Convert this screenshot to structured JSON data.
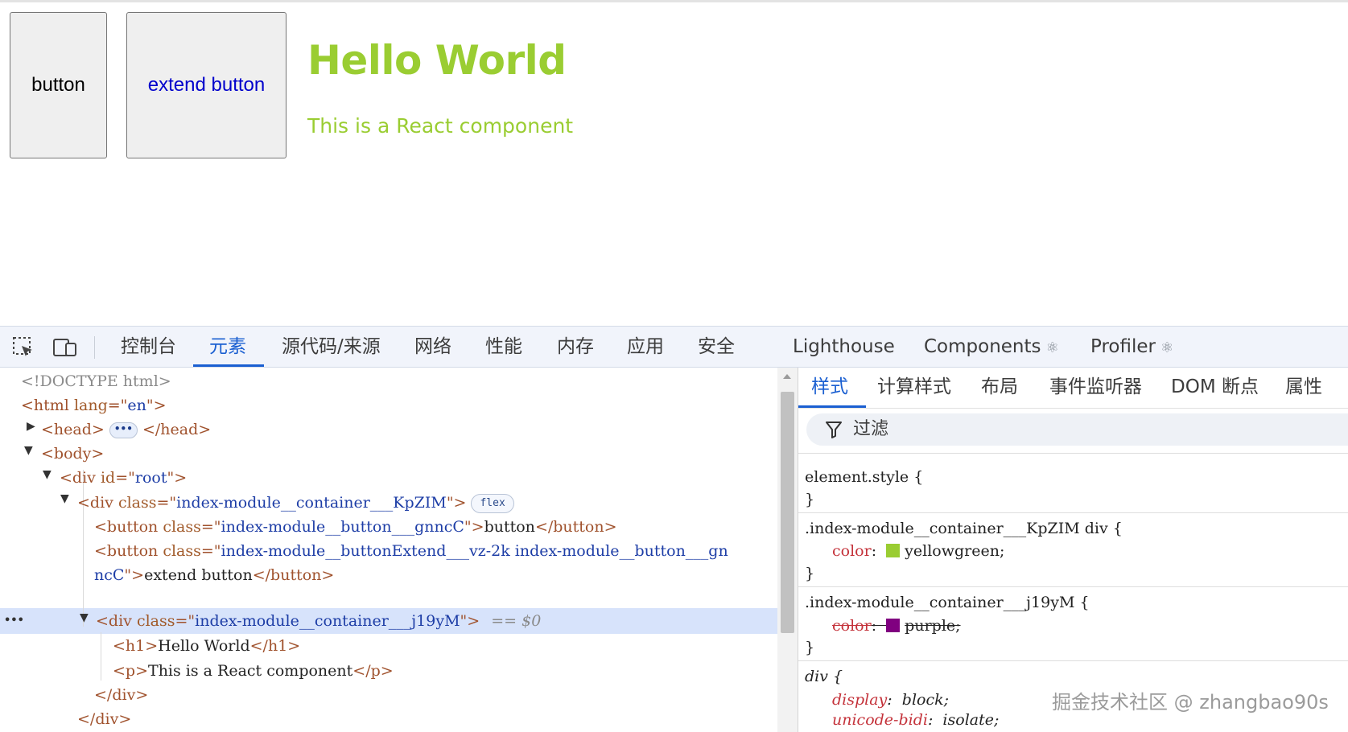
{
  "page": {
    "button1_label": "button",
    "button2_label": "extend button",
    "heading": "Hello World",
    "paragraph": "This is a React component",
    "colors": {
      "heading": "#9acd32",
      "extend_button_text": "#0000cc"
    }
  },
  "devtools": {
    "toolbar": {
      "icons": [
        "inspect-element-icon",
        "device-toolbar-icon"
      ],
      "tabs": {
        "console": "控制台",
        "elements": "元素",
        "sources": "源代码/来源",
        "network": "网络",
        "performance": "性能",
        "memory": "内存",
        "application": "应用",
        "security": "安全",
        "lighthouse": "Lighthouse",
        "components": "Components",
        "profiler": "Profiler"
      },
      "react_glyph": "⚛",
      "active_tab": "元素"
    },
    "elements": {
      "doctype": "<!DOCTYPE html>",
      "html_tag": "html",
      "html_attr": "lang",
      "html_val": "en",
      "head_tag": "head",
      "body_tag": "body",
      "root_tag": "div",
      "root_attr": "id",
      "root_val": "root",
      "container_attr": "class",
      "container_val": "index-module__container___KpZIM",
      "flex_badge": "flex",
      "button1_tag": "button",
      "button1_class": "index-module__button___gnncC",
      "button1_text": "button",
      "button2_class_line1": "index-module__buttonExtend___vz-2k index-module__button___gn",
      "button2_class_line2": "ncC",
      "button2_text": "extend button",
      "inner_container_val": "index-module__container___j19yM",
      "selected_marker": "== $0",
      "h1_tag": "h1",
      "h1_text": "Hello World",
      "p_tag": "p",
      "p_text": "This is a React component",
      "close_div": "div",
      "row_menu": "•••",
      "ellipsis": "•••"
    },
    "styles": {
      "tabs": {
        "styles": "样式",
        "computed": "计算样式",
        "layout": "布局",
        "event_listeners": "事件监听器",
        "dom_breakpoints": "DOM 断点",
        "properties": "属性"
      },
      "filter_placeholder": "过滤",
      "element_style": "element.style {",
      "close_brace": "}",
      "rule1_selector": ".index-module__container___KpZIM div {",
      "rule1_prop": "color",
      "rule1_value": "yellowgreen;",
      "rule1_swatch": "#9acd32",
      "rule2_selector": ".index-module__container___j19yM {",
      "rule2_prop": "color",
      "rule2_value": "purple;",
      "rule2_swatch": "#800080",
      "ua_selector": "div {",
      "ua_prop1": "display",
      "ua_val1": "block;",
      "ua_prop2": "unicode-bidi",
      "ua_val2": "isolate;"
    }
  },
  "watermark": "掘金技术社区 @ zhangbao90s"
}
